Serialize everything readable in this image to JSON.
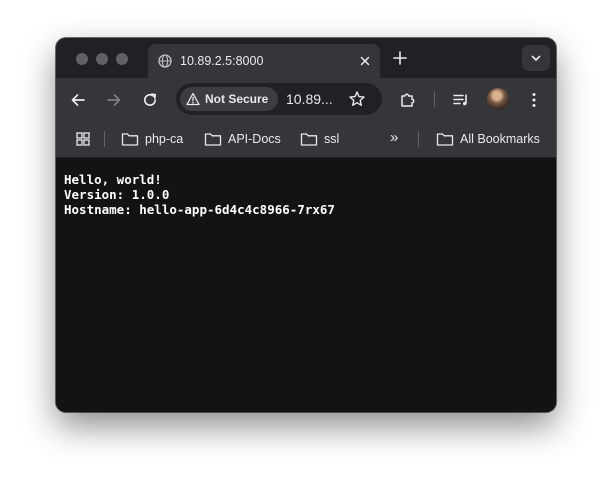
{
  "tab": {
    "title": "10.89.2.5:8000",
    "favicon": "globe-icon"
  },
  "toolbar": {
    "security_label": "Not Secure",
    "url_display": "10.89..."
  },
  "bookmarks": {
    "items": [
      {
        "label": "php-ca",
        "icon": "folder-icon"
      },
      {
        "label": "API-Docs",
        "icon": "folder-icon"
      },
      {
        "label": "ssl",
        "icon": "folder-icon"
      }
    ],
    "overflow": "»",
    "all_bookmarks": "All Bookmarks"
  },
  "page": {
    "lines": [
      "Hello, world!",
      "Version: 1.0.0",
      "Hostname: hello-app-6d4c4c8966-7rx67"
    ]
  },
  "colors": {
    "frame": "#202124",
    "toolbar": "#35363a",
    "content_bg": "#131313",
    "text": "#e8eaed"
  }
}
